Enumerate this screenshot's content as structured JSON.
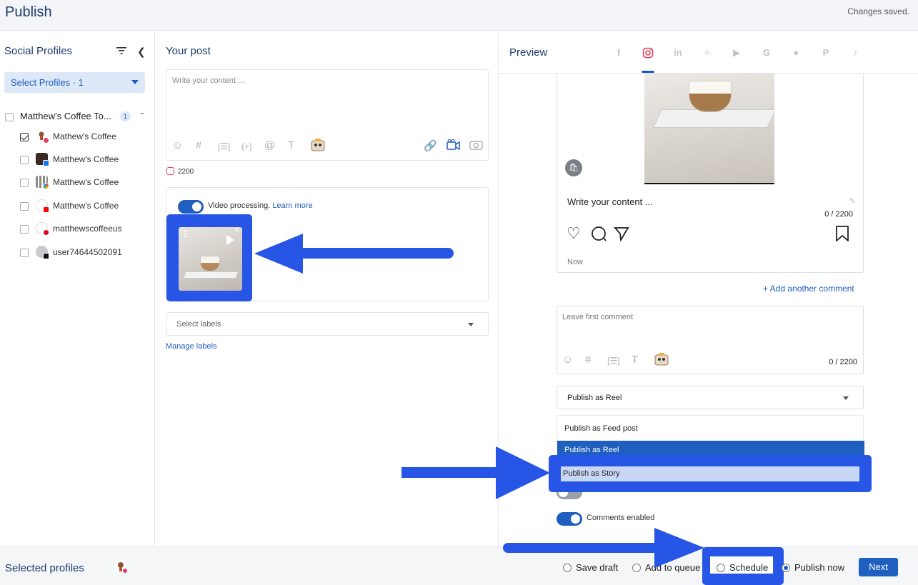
{
  "header": {
    "title": "Publish",
    "save_status": "Changes saved."
  },
  "left": {
    "title": "Social Profiles",
    "select_profiles": "Select Profiles · 1",
    "group": {
      "label": "Matthew's Coffee To...",
      "count": "1"
    },
    "profiles": [
      {
        "name": "Mathew's Coffee",
        "network": "instagram",
        "checked": true
      },
      {
        "name": "Matthew's Coffee",
        "network": "facebook",
        "checked": false
      },
      {
        "name": "Matthew's Coffee",
        "network": "google",
        "checked": false
      },
      {
        "name": "Matthew's Coffee",
        "network": "youtube",
        "checked": false
      },
      {
        "name": "matthewscoffeeus",
        "network": "pinterest",
        "checked": false
      },
      {
        "name": "user74644502091",
        "network": "tiktok",
        "checked": false
      }
    ]
  },
  "middle": {
    "title": "Your post",
    "editor_placeholder": "Write your content ...",
    "char_limit": "2200",
    "video_processing": "Video processing.",
    "learn_more": "Learn more",
    "select_labels": "Select labels",
    "manage_labels": "Manage labels"
  },
  "preview": {
    "title": "Preview",
    "card_placeholder": "Write your content ...",
    "card_count": "0 / 2200",
    "time": "Now",
    "add_comment": "+ Add another comment",
    "comment_placeholder": "Leave first comment",
    "comment_count": "0 / 2200",
    "publish_selected": "Publish as Reel",
    "options": [
      "Publish as Feed post",
      "Publish as Reel",
      "Publish as Story"
    ],
    "comments_enabled": "Comments enabled"
  },
  "footer": {
    "selected_profiles": "Selected profiles",
    "save_draft": "Save draft",
    "add_to_queue": "Add to queue",
    "schedule": "Schedule",
    "publish_now": "Publish now",
    "next": "Next"
  },
  "colors": {
    "primary": "#1f5fbf",
    "annotation": "#2756e6",
    "instagram": "#e4405f"
  }
}
